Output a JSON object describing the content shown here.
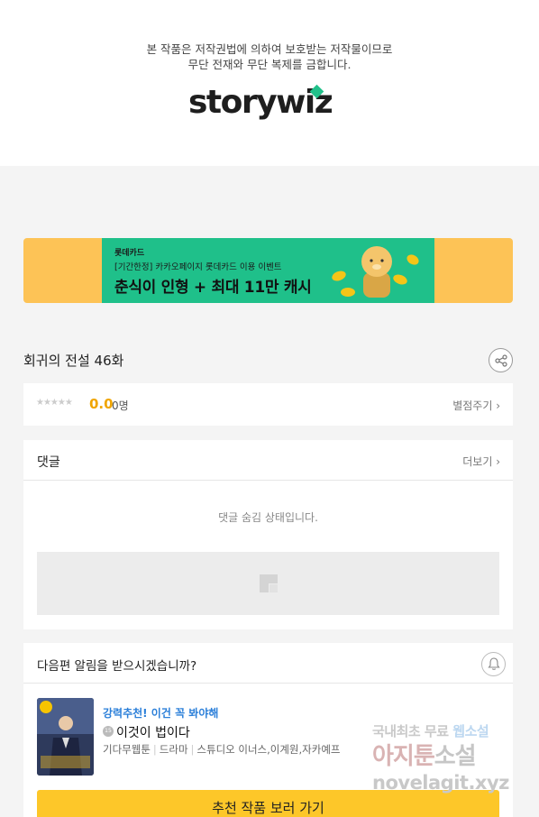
{
  "header": {
    "copyright_line1": "본 작품은 저작권법에 의하여 보호받는 저작물이므로",
    "copyright_line2": "무단 전재와 무단 복제를 금합니다.",
    "logo_text": "storywiz"
  },
  "banner": {
    "brand": "롯데카드",
    "subtitle": "[기간한정] 카카오페이지 롯데카드 이용 이벤트",
    "headline": "춘식이 인형 + 최대 11만 캐시"
  },
  "episode": {
    "title": "회귀의 전설 46화"
  },
  "rating": {
    "stars": "★★★★★",
    "score": "0.0",
    "count": "0명",
    "rate_link": "별점주기 ›"
  },
  "comments": {
    "title": "댓글",
    "more": "더보기 ›",
    "hidden_message": "댓글 숨김 상태입니다."
  },
  "notify": {
    "question": "다음편 알림을 받으시겠습니까?",
    "recommend_tag": "강력추천! 이건 꼭 봐야해",
    "age_badge": "15",
    "work_title": "이것이 법이다",
    "genre1": "기다무웹툰",
    "genre2": "드라마",
    "authors": "스튜디오 이너스,이계원,자카예프",
    "cta": "추천 작품 보러 가기"
  },
  "watermark": {
    "line1_a": "국내최초 무료",
    "line1_b": "웹소설",
    "line2_a": "아지툰",
    "line2_b": "소설",
    "line3": "novelagit.xyz"
  },
  "colors": {
    "accent_yellow": "#fdc729",
    "score_orange": "#f0a500",
    "link_blue": "#2b7fd9",
    "banner_green": "#1fc08a"
  }
}
